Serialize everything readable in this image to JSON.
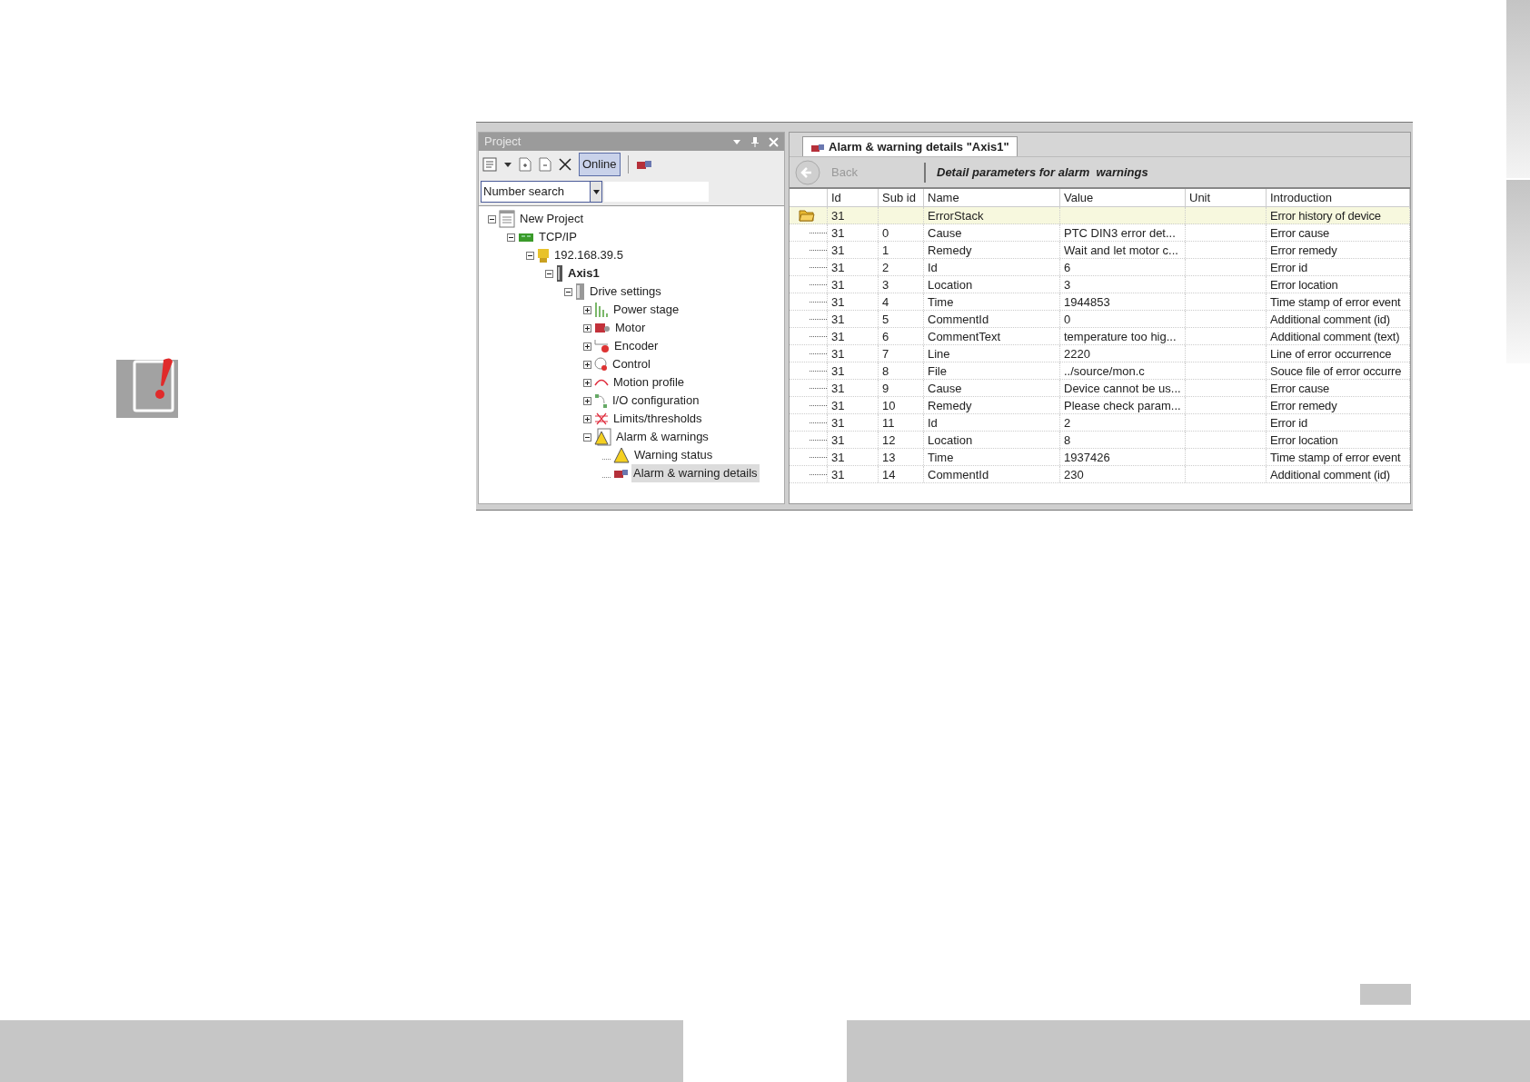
{
  "project_panel": {
    "title": "Project",
    "online_button": {
      "label": "Online",
      "selected": true
    },
    "search": {
      "value": "Number search"
    },
    "tree": [
      {
        "label": "New Project",
        "kind": "project",
        "expanded": true,
        "selected": false,
        "bold": false,
        "children": [
          {
            "label": "TCP/IP",
            "kind": "network",
            "expanded": true,
            "selected": false,
            "bold": false,
            "children": [
              {
                "label": "192.168.39.5",
                "kind": "host",
                "expanded": true,
                "selected": false,
                "bold": false,
                "children": [
                  {
                    "label": "Axis1",
                    "kind": "axis",
                    "expanded": true,
                    "selected": false,
                    "bold": true,
                    "children": [
                      {
                        "label": "Drive settings",
                        "kind": "drive",
                        "expanded": true,
                        "selected": false,
                        "bold": false,
                        "children": [
                          {
                            "label": "Power stage",
                            "kind": "power",
                            "expanded": false,
                            "selected": false,
                            "bold": false
                          },
                          {
                            "label": "Motor",
                            "kind": "motor",
                            "expanded": false,
                            "selected": false,
                            "bold": false
                          },
                          {
                            "label": "Encoder",
                            "kind": "encoder",
                            "expanded": false,
                            "selected": false,
                            "bold": false
                          },
                          {
                            "label": "Control",
                            "kind": "control",
                            "expanded": false,
                            "selected": false,
                            "bold": false
                          },
                          {
                            "label": "Motion profile",
                            "kind": "motion",
                            "expanded": false,
                            "selected": false,
                            "bold": false
                          },
                          {
                            "label": "I/O configuration",
                            "kind": "io",
                            "expanded": false,
                            "selected": false,
                            "bold": false
                          },
                          {
                            "label": "Limits/thresholds",
                            "kind": "limits",
                            "expanded": false,
                            "selected": false,
                            "bold": false
                          },
                          {
                            "label": "Alarm & warnings",
                            "kind": "alarm",
                            "expanded": true,
                            "selected": false,
                            "bold": false,
                            "children": [
                              {
                                "label": "Warning status",
                                "kind": "warning",
                                "selected": false,
                                "bold": false
                              },
                              {
                                "label": "Alarm & warning details",
                                "kind": "details",
                                "selected": true,
                                "bold": false
                              }
                            ]
                          }
                        ]
                      }
                    ]
                  }
                ]
              }
            ]
          }
        ]
      }
    ]
  },
  "details_panel": {
    "tab": {
      "label": "Alarm & warning details \"Axis1\"",
      "selected": true
    },
    "back_button": {
      "label": "Back",
      "disabled": true
    },
    "heading": "Detail parameters for alarm  warnings",
    "table": {
      "columns": [
        "Id",
        "Sub id",
        "Name",
        "Value",
        "Unit",
        "Introduction"
      ],
      "rows": [
        {
          "kind": "group",
          "selected": true,
          "cells": [
            "31",
            "",
            "ErrorStack",
            "",
            "",
            "Error history of device"
          ]
        },
        {
          "kind": "item",
          "selected": false,
          "cells": [
            "31",
            "0",
            "Cause",
            "PTC DIN3 error det...",
            "",
            "Error cause"
          ]
        },
        {
          "kind": "item",
          "selected": false,
          "cells": [
            "31",
            "1",
            "Remedy",
            "Wait and let motor c...",
            "",
            "Error remedy"
          ]
        },
        {
          "kind": "item",
          "selected": false,
          "cells": [
            "31",
            "2",
            "Id",
            "6",
            "",
            "Error id"
          ]
        },
        {
          "kind": "item",
          "selected": false,
          "cells": [
            "31",
            "3",
            "Location",
            "3",
            "",
            "Error location"
          ]
        },
        {
          "kind": "item",
          "selected": false,
          "cells": [
            "31",
            "4",
            "Time",
            "1944853",
            "",
            "Time stamp of error event"
          ]
        },
        {
          "kind": "item",
          "selected": false,
          "cells": [
            "31",
            "5",
            "CommentId",
            "0",
            "",
            "Additional comment (id)"
          ]
        },
        {
          "kind": "item",
          "selected": false,
          "cells": [
            "31",
            "6",
            "CommentText",
            "temperature  too hig...",
            "",
            "Additional comment (text)"
          ]
        },
        {
          "kind": "item",
          "selected": false,
          "cells": [
            "31",
            "7",
            "Line",
            "2220",
            "",
            "Line of error occurrence"
          ]
        },
        {
          "kind": "item",
          "selected": false,
          "cells": [
            "31",
            "8",
            "File",
            "../source/mon.c",
            "",
            "Souce file of error occurre"
          ]
        },
        {
          "kind": "item",
          "selected": false,
          "cells": [
            "31",
            "9",
            "Cause",
            "Device cannot be us...",
            "",
            "Error cause"
          ]
        },
        {
          "kind": "item",
          "selected": false,
          "cells": [
            "31",
            "10",
            "Remedy",
            "Please check param...",
            "",
            "Error remedy"
          ]
        },
        {
          "kind": "item",
          "selected": false,
          "cells": [
            "31",
            "11",
            "Id",
            "2",
            "",
            "Error id"
          ]
        },
        {
          "kind": "item",
          "selected": false,
          "cells": [
            "31",
            "12",
            "Location",
            "8",
            "",
            "Error location"
          ]
        },
        {
          "kind": "item",
          "selected": false,
          "cells": [
            "31",
            "13",
            "Time",
            "1937426",
            "",
            "Time stamp of error event"
          ]
        },
        {
          "kind": "item",
          "selected": false,
          "cells": [
            "31",
            "14",
            "CommentId",
            "230",
            "",
            "Additional comment (id)"
          ]
        }
      ]
    }
  }
}
